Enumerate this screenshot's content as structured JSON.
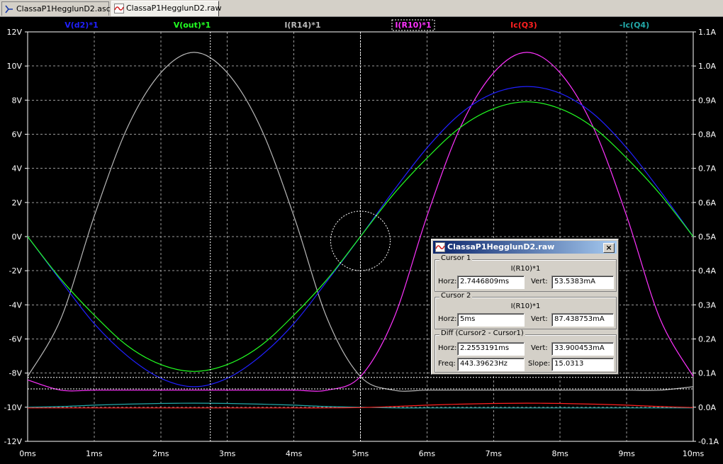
{
  "tabs": [
    {
      "label": "ClassaP1HegglunD2.asc",
      "icon": "schematic-icon",
      "active": false
    },
    {
      "label": "ClassaP1HegglunD2.raw",
      "icon": "waveform-icon",
      "active": true
    }
  ],
  "plot": {
    "background": "#000000",
    "grid_color": "#9a9a9a",
    "x_ticks": [
      "0ms",
      "1ms",
      "2ms",
      "3ms",
      "4ms",
      "5ms",
      "6ms",
      "7ms",
      "8ms",
      "9ms",
      "10ms"
    ],
    "y_left_ticks": [
      "12V",
      "10V",
      "8V",
      "6V",
      "4V",
      "2V",
      "0V",
      "-2V",
      "-4V",
      "-6V",
      "-8V",
      "-10V",
      "-12V"
    ],
    "y_right_ticks": [
      "1.1A",
      "1.0A",
      "0.9A",
      "0.8A",
      "0.7A",
      "0.6A",
      "0.5A",
      "0.4A",
      "0.3A",
      "0.2A",
      "0.1A",
      "0.0A",
      "-0.1A"
    ],
    "traces": [
      {
        "label": "V(d2)*1",
        "color": "#2020ff"
      },
      {
        "label": "V(out)*1",
        "color": "#22ff22"
      },
      {
        "label": "I(R14)*1",
        "color": "#b8b8b8"
      },
      {
        "label": "I(R10)*1",
        "color": "#ff33ff"
      },
      {
        "label": "Ic(Q3)",
        "color": "#ff2020"
      },
      {
        "label": "-Ic(Q4)",
        "color": "#22a8a8"
      }
    ]
  },
  "chart_data": {
    "type": "line",
    "xlabel": "",
    "x_unit": "ms",
    "xlim": [
      0,
      10
    ],
    "left_axis": {
      "unit": "V",
      "lim": [
        -12,
        12
      ]
    },
    "right_axis": {
      "unit": "A",
      "lim": [
        -0.1,
        1.1
      ]
    },
    "grid": true,
    "legend": "top",
    "x": [
      0,
      0.5,
      1,
      1.5,
      2,
      2.5,
      3,
      3.5,
      4,
      4.5,
      5,
      5.5,
      6,
      6.5,
      7,
      7.5,
      8,
      8.5,
      9,
      9.5,
      10
    ],
    "series": [
      {
        "name": "V(d2)*1",
        "axis": "left",
        "color": "#2020ff",
        "values": [
          0,
          -2.6,
          -5.1,
          -7.0,
          -8.3,
          -8.8,
          -8.3,
          -7.0,
          -5.1,
          -2.6,
          0,
          2.7,
          5.2,
          7.2,
          8.4,
          8.8,
          8.4,
          7.2,
          5.2,
          2.7,
          0
        ]
      },
      {
        "name": "V(out)*1",
        "axis": "left",
        "color": "#22ff22",
        "values": [
          0,
          -2.5,
          -4.6,
          -6.4,
          -7.5,
          -7.9,
          -7.5,
          -6.4,
          -4.6,
          -2.5,
          0,
          2.5,
          4.6,
          6.4,
          7.5,
          7.9,
          7.5,
          6.4,
          4.6,
          2.5,
          0
        ]
      },
      {
        "name": "I(R14)*1",
        "axis": "right",
        "color": "#b8b8b8",
        "values": [
          0.09,
          0.26,
          0.56,
          0.82,
          0.98,
          1.04,
          0.98,
          0.82,
          0.56,
          0.26,
          0.09,
          0.05,
          0.05,
          0.05,
          0.05,
          0.05,
          0.05,
          0.05,
          0.05,
          0.05,
          0.06
        ]
      },
      {
        "name": "I(R10)*1",
        "axis": "right",
        "color": "#ff33ff",
        "values": [
          0.08,
          0.05,
          0.05,
          0.05,
          0.05,
          0.05,
          0.05,
          0.05,
          0.05,
          0.05,
          0.09,
          0.26,
          0.56,
          0.82,
          0.98,
          1.04,
          0.98,
          0.82,
          0.56,
          0.26,
          0.09
        ]
      },
      {
        "name": "Ic(Q3)",
        "axis": "right",
        "color": "#ff2020",
        "values": [
          -0.002,
          -0.002,
          -0.002,
          -0.002,
          -0.002,
          -0.002,
          -0.002,
          -0.002,
          -0.002,
          -0.002,
          -0.001,
          0.002,
          0.006,
          0.009,
          0.011,
          0.012,
          0.011,
          0.009,
          0.006,
          0.002,
          -0.001
        ]
      },
      {
        "name": "-Ic(Q4)",
        "axis": "right",
        "color": "#22a8a8",
        "values": [
          0.0,
          0.002,
          0.006,
          0.009,
          0.011,
          0.012,
          0.011,
          0.009,
          0.006,
          0.002,
          0.0,
          -0.002,
          -0.002,
          -0.002,
          -0.002,
          -0.002,
          -0.002,
          -0.002,
          -0.002,
          -0.002,
          -0.002
        ]
      }
    ],
    "cursors": [
      {
        "name": "Cursor 1",
        "x": 2.7446809,
        "value": 0.0535383
      },
      {
        "name": "Cursor 2",
        "x": 5,
        "value": 0.087438753
      }
    ]
  },
  "cursor_dialog": {
    "title": "ClassaP1HegglunD2.raw",
    "close": "×",
    "cursor1": {
      "heading": "Cursor 1",
      "trace": "I(R10)*1",
      "horz_label": "Horz:",
      "horz": "2.7446809ms",
      "vert_label": "Vert:",
      "vert": "53.5383mA"
    },
    "cursor2": {
      "heading": "Cursor 2",
      "trace": "I(R10)*1",
      "horz_label": "Horz:",
      "horz": "5ms",
      "vert_label": "Vert:",
      "vert": "87.438753mA"
    },
    "diff": {
      "heading": "Diff (Cursor2 - Cursor1)",
      "horz_label": "Horz:",
      "horz": "2.2553191ms",
      "vert_label": "Vert:",
      "vert": "33.900453mA",
      "freq_label": "Freq:",
      "freq": "443.39623Hz",
      "slope_label": "Slope:",
      "slope": "15.0313"
    }
  }
}
